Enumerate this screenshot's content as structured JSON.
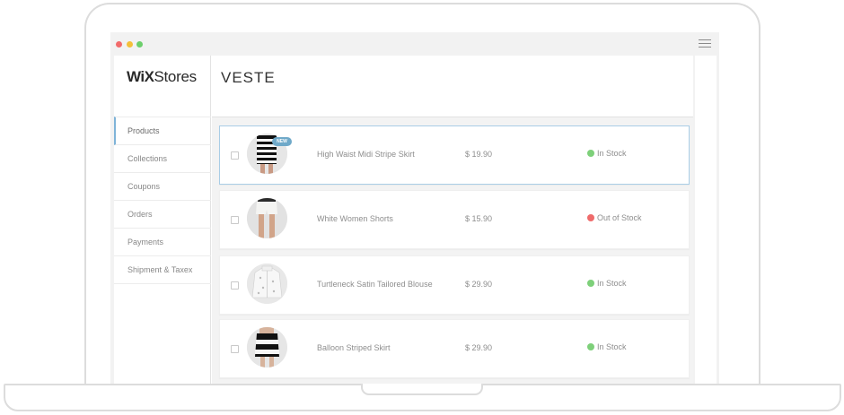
{
  "window": {
    "dots": [
      "#f26b6b",
      "#f4c03a",
      "#6ccf6c"
    ]
  },
  "logo": {
    "bold": "WiX",
    "light": "Stores"
  },
  "sidebar": {
    "items": [
      {
        "label": "Products",
        "active": true
      },
      {
        "label": "Collections"
      },
      {
        "label": "Coupons"
      },
      {
        "label": "Orders"
      },
      {
        "label": "Payments"
      },
      {
        "label": "Shipment & Taxex"
      }
    ]
  },
  "page": {
    "title": "VESTE"
  },
  "products": [
    {
      "name": "High Waist Midi Stripe Skirt",
      "price": "$ 19.90",
      "status": "In Stock",
      "status_color": "#7ed07a",
      "badge": "NEW",
      "selected": true,
      "thumb": "striped-skirt"
    },
    {
      "name": "White Women Shorts",
      "price": "$ 15.90",
      "status": "Out of Stock",
      "status_color": "#ef6b6b",
      "selected": false,
      "thumb": "white-shorts"
    },
    {
      "name": "Turtleneck Satin Tailored Blouse",
      "price": "$ 29.90",
      "status": "In Stock",
      "status_color": "#7ed07a",
      "selected": false,
      "thumb": "blouse"
    },
    {
      "name": "Balloon Striped Skirt",
      "price": "$ 29.90",
      "status": "In Stock",
      "status_color": "#7ed07a",
      "selected": false,
      "thumb": "balloon-skirt"
    }
  ],
  "colors": {
    "accent": "#7fb4d8",
    "selected_border": "#a9cde6"
  }
}
